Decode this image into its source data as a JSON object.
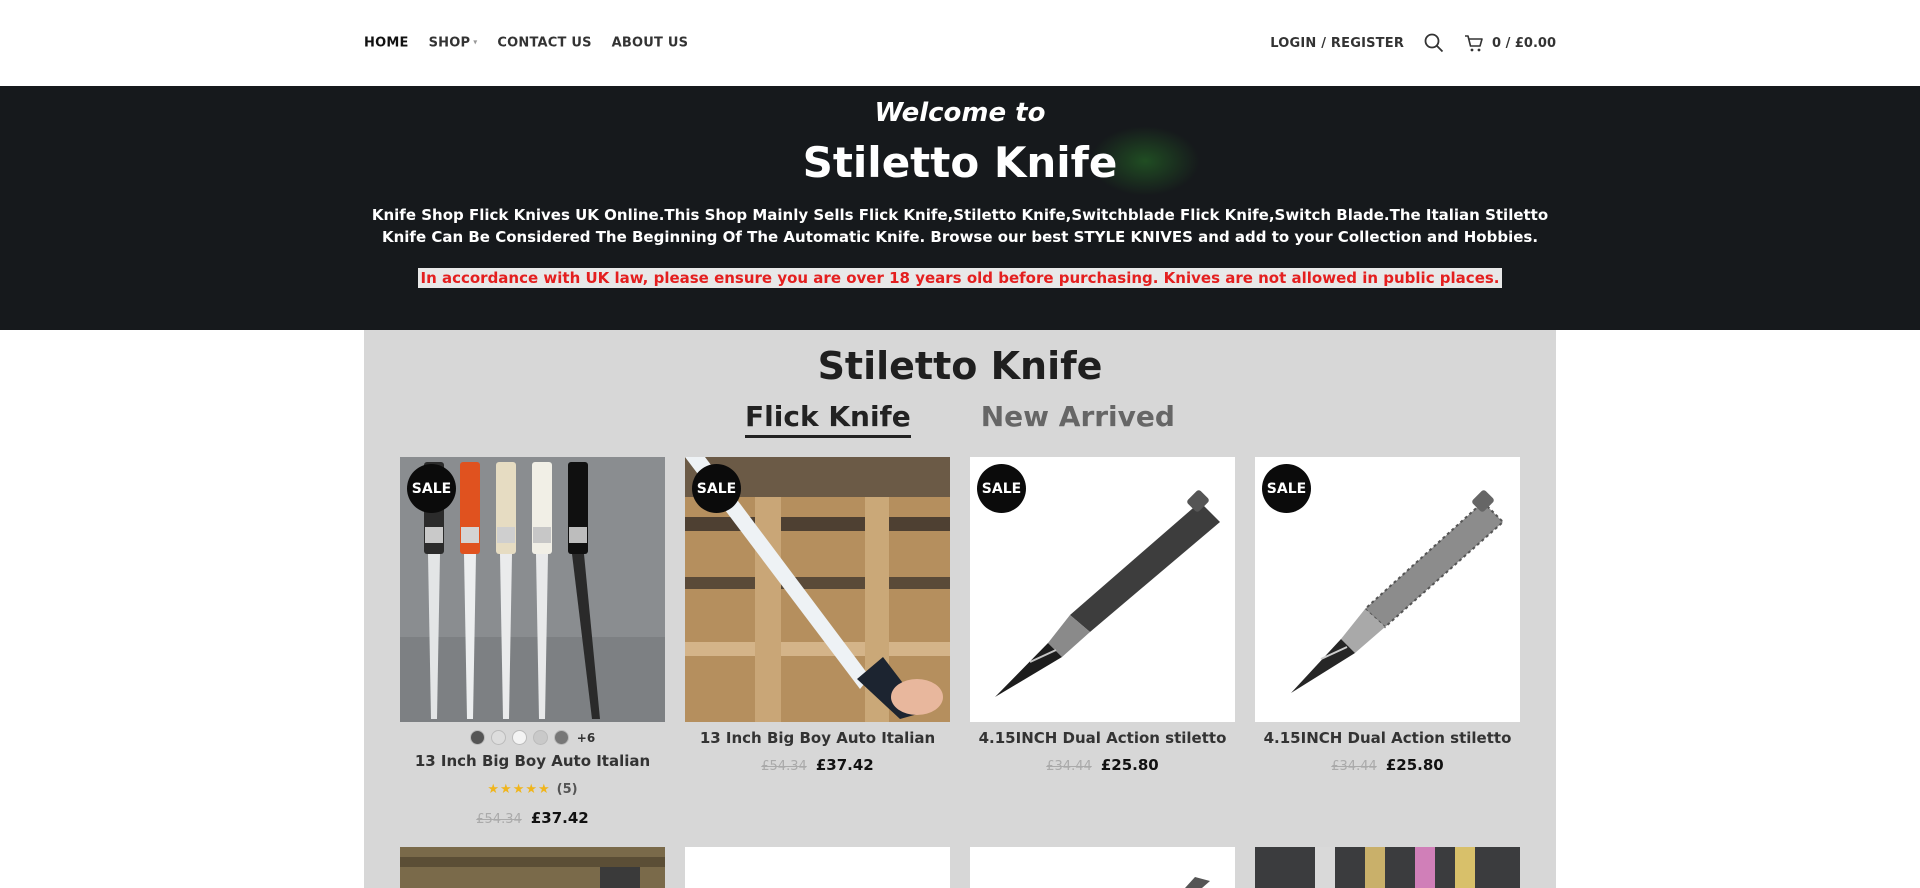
{
  "nav": {
    "items": [
      "HOME",
      "SHOP",
      "CONTACT US",
      "ABOUT US"
    ],
    "login": "LOGIN / REGISTER",
    "cart": "0 / £0.00"
  },
  "hero": {
    "welcome": "Welcome to",
    "title": "Stiletto Knife",
    "description": "Knife Shop Flick Knives UK Online.This Shop Mainly Sells Flick Knife,Stiletto Knife,Switchblade Flick Knife,Switch Blade.The Italian Stiletto Knife Can Be Considered The Beginning Of The Automatic Knife. Browse our best STYLE KNIVES and add to your Collection and Hobbies.",
    "warning": "In accordance with UK law, please ensure you are over 18 years old before purchasing. Knives are not allowed in public places."
  },
  "section": {
    "title": "Stiletto Knife",
    "tabs": [
      "Flick Knife",
      "New Arrived"
    ]
  },
  "products": [
    {
      "badge": "SALE",
      "name": "13 Inch Big Boy Auto Italian",
      "swatches_more": "+6",
      "rating_stars": "★★★★★",
      "rating_count": "(5)",
      "rating_value": 5,
      "old_price": "£54.34",
      "price": "£37.42"
    },
    {
      "badge": "SALE",
      "name": "13 Inch Big Boy Auto Italian",
      "old_price": "£54.34",
      "price": "£37.42"
    },
    {
      "badge": "SALE",
      "name": "4.15INCH Dual Action stiletto",
      "old_price": "£34.44",
      "price": "£25.80"
    },
    {
      "badge": "SALE",
      "name": "4.15INCH Dual Action stiletto",
      "old_price": "£34.44",
      "price": "£25.80"
    }
  ],
  "colors": {
    "hero_bg": "#16191c",
    "warning_text": "#e41f1f",
    "section_bg": "#d7d7d7",
    "star": "#f0b51c",
    "badge_bg": "#0b0b0b"
  }
}
